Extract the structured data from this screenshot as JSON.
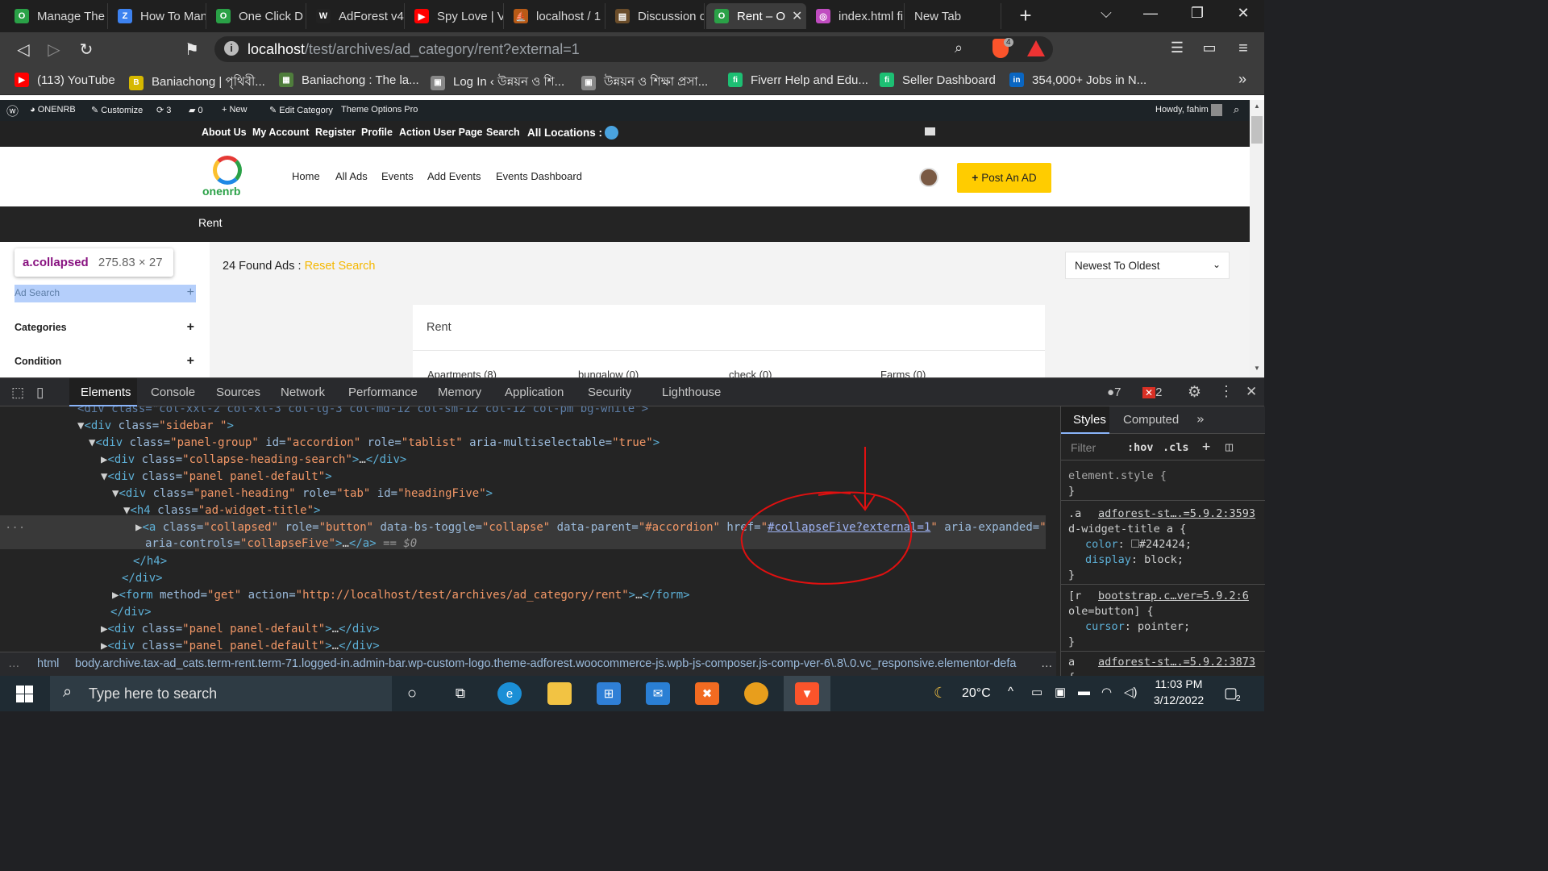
{
  "browser": {
    "tabs": [
      {
        "label": "Manage The",
        "color": "#2aa147",
        "glyph": "O"
      },
      {
        "label": "How To Man",
        "color": "#3d82f0",
        "glyph": "Z"
      },
      {
        "label": "One Click D",
        "color": "#2aa147",
        "glyph": "O"
      },
      {
        "label": "AdForest v4",
        "color": "#222222",
        "glyph": "W"
      },
      {
        "label": "Spy Love | V",
        "color": "#ff0000",
        "glyph": "▶"
      },
      {
        "label": "localhost / 1",
        "color": "#b85a16",
        "glyph": "⛵"
      },
      {
        "label": "Discussion o",
        "color": "#6b4d2a",
        "glyph": "▤"
      },
      {
        "label": "Rent – O",
        "color": "#2aa147",
        "glyph": "O",
        "active": true
      },
      {
        "label": "index.html fi",
        "color": "#c04cc0",
        "glyph": "◎"
      },
      {
        "label": "New Tab",
        "color": "",
        "glyph": ""
      }
    ],
    "new_tab_symbol": "+",
    "url_host": "localhost",
    "url_path": "/test/archives/ad_category/rent?external=1",
    "shield_count": "4",
    "bookmarks": [
      {
        "label": "(113) YouTube",
        "color": "#ff0000",
        "glyph": "▶"
      },
      {
        "label": "Baniachong | পৃথিবী...",
        "color": "#d6b800",
        "glyph": "B"
      },
      {
        "label": "Baniachong : The la...",
        "color": "#4f7d3c",
        "glyph": "▦"
      },
      {
        "label": "Log In ‹ উন্নয়ন ও শি...",
        "color": "#888888",
        "glyph": "▣"
      },
      {
        "label": "উন্নয়ন ও শিক্ষা প্রসা...",
        "color": "#888888",
        "glyph": "▣"
      },
      {
        "label": "Fiverr Help and Edu...",
        "color": "#1dbf73",
        "glyph": "fi"
      },
      {
        "label": "Seller Dashboard",
        "color": "#1dbf73",
        "glyph": "fi"
      },
      {
        "label": "354,000+ Jobs in N...",
        "color": "#0a66c2",
        "glyph": "in"
      }
    ],
    "more_bookmarks": "»"
  },
  "wp_admin": {
    "site": "ONENRB",
    "customize": "Customize",
    "updates": "3",
    "comments": "0",
    "new": "New",
    "edit_category": "Edit Category",
    "theme_options": "Theme Options Pro",
    "howdy": "Howdy, fahim"
  },
  "site": {
    "top_links": [
      "About Us",
      "My Account",
      "Register",
      "Profile",
      "Action User Page",
      "Search",
      "All Locations :"
    ],
    "logo_text": "onenrb",
    "menu": [
      "Home",
      "All Ads",
      "Events",
      "Add Events",
      "Events Dashboard"
    ],
    "post_ad": "Post An AD",
    "breadcrumb": "Rent",
    "found_count": "24 Found Ads :",
    "reset_search": "Reset Search",
    "sort_selected": "Newest To Oldest",
    "card_title": "Rent",
    "subcategories": [
      "Apartments (8)",
      "bungalow (0)",
      "check (0)",
      "Farms (0)"
    ],
    "sidebar": [
      {
        "label": "Ad Search"
      },
      {
        "label": "Categories"
      },
      {
        "label": "Condition"
      }
    ],
    "tooltip_selector": "a.collapsed",
    "tooltip_size": "275.83 × 27"
  },
  "devtools": {
    "tabs": [
      "Elements",
      "Console",
      "Sources",
      "Network",
      "Performance",
      "Memory",
      "Application",
      "Security",
      "Lighthouse"
    ],
    "warnings": "7",
    "errors": "2",
    "style_tabs": [
      "Styles",
      "Computed"
    ],
    "filter_placeholder": "Filter",
    "hov": ":hov",
    "cls": ".cls",
    "eq_dollar": "== $0",
    "breadcrumb_html": "html",
    "breadcrumb_body": "body.archive.tax-ad_cats.term-rent.term-71.logged-in.admin-bar.wp-custom-logo.theme-adforest.woocommerce-js.wpb-js-composer.js-comp-ver-6\\.8\\.0.vc_responsive.elementor-defa",
    "style_rules": [
      {
        "selector": "element.style {",
        "source": ""
      },
      {
        "selector": ".a",
        "source": "adforest-st….=5.9.2:3593",
        "selector2": "d-widget-title a {",
        "props": [
          [
            "color",
            "#242424"
          ],
          [
            "display",
            "block"
          ]
        ]
      },
      {
        "selector": "[r",
        "source": "bootstrap.c…ver=5.9.2:6",
        "selector2": "ole=button] {",
        "props": [
          [
            "cursor",
            "pointer"
          ]
        ]
      },
      {
        "selector": "a",
        "source": "adforest-st….=5.9.2:3873",
        "selector2": "{"
      }
    ]
  },
  "taskbar": {
    "search_placeholder": "Type here to search",
    "temperature": "20°C",
    "time": "11:03 PM",
    "date": "3/12/2022",
    "notifications": "2"
  }
}
